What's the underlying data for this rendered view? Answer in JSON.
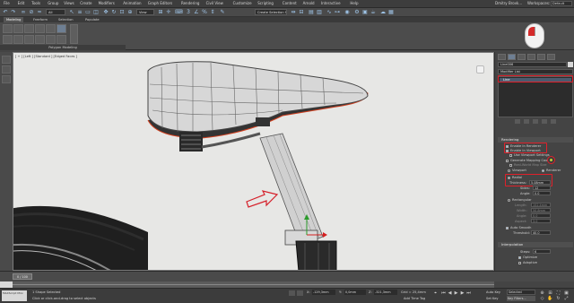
{
  "menubar": {
    "items": [
      "File",
      "Edit",
      "Tools",
      "Group",
      "Views",
      "Create",
      "Modifiers",
      "Animation",
      "Graph Editors",
      "Rendering",
      "Civil View",
      "Customize",
      "Scripting",
      "Content",
      "Arnold",
      "Interactive",
      "Help"
    ],
    "user": "Dmitry Brovk...",
    "workspace_label": "Workspaces:",
    "workspace_value": "Default"
  },
  "toolbar": {
    "filter_value": "All",
    "view_value": "View",
    "selection_set_placeholder": "Create Selection Se"
  },
  "ribbon": {
    "tabs": [
      "Modeling",
      "Freeform",
      "Selection",
      "Populate"
    ],
    "active_tab": "Modeling",
    "panel_label": "Polygon Modeling"
  },
  "viewport": {
    "label": "[ + ] [Left ] [Standard ] [Edged Faces ]"
  },
  "command_panel": {
    "object_name": "Line006",
    "modifier_list": "Modifier List",
    "stack_item": "Line",
    "rendering_header": "Rendering",
    "enable_in_renderer": "Enable In Renderer",
    "enable_in_viewport": "Enable In Viewport",
    "use_viewport_settings": "Use Viewport Settings",
    "generate_mapping": "Generate Mapping Coords.",
    "real_world": "Real-World Map Size",
    "viewport_radio": "Viewport",
    "renderer_radio": "Renderer",
    "radial": "Radial",
    "thickness_label": "Thickness:",
    "thickness_value": "5,08mm",
    "sides_label": "Sides:",
    "sides_value": "12",
    "angle_label": "Angle:",
    "angle_value": "0,0",
    "rectangular": "Rectangular",
    "length_label": "Length:",
    "length_value": "152,4mm",
    "width_label": "Width:",
    "width_value": "50,8mm",
    "rect_angle_label": "Angle:",
    "rect_angle_value": "0,0",
    "aspect_label": "Aspect:",
    "aspect_value": "3,0",
    "auto_smooth": "Auto Smooth",
    "threshold_label": "Threshold:",
    "threshold_value": "40,0",
    "interpolation_header": "Interpolation",
    "steps_label": "Steps:",
    "steps_value": "6",
    "optimize": "Optimize",
    "adaptive": "Adaptive"
  },
  "timeline": {
    "frame_display": "0 / 100"
  },
  "status": {
    "shapes_selected": "1 Shape Selected",
    "prompt": "Click or click-and-drag to select objects",
    "x_label": "X:",
    "x_value": "-129,3mm",
    "y_label": "Y:",
    "y_value": "0,0mm",
    "z_label": "Z:",
    "z_value": "-321,3mm",
    "grid": "Grid = 25,4mm",
    "add_time_tag": "Add Time Tag",
    "auto_key": "Auto Key",
    "set_key": "Set Key",
    "selected_value": "Selected",
    "key_filters": "Key Filters...",
    "maxscript": "MAXScript Mini"
  },
  "colors": {
    "highlight_red": "#e0202a",
    "accent_blue": "#9ec3e6",
    "arrow_red": "#d5202a"
  }
}
